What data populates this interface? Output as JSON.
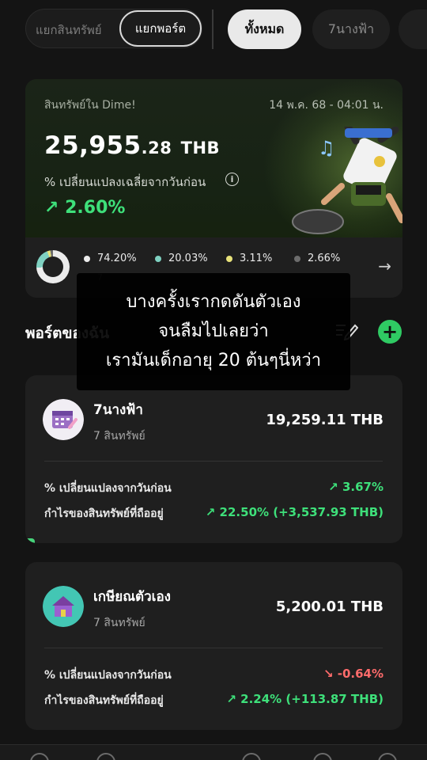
{
  "topbar": {
    "segment_left": "แยกสินทรัพย์",
    "segment_right": "แยกพอร์ต",
    "filter_all": "ทั้งหมด",
    "filter_7": "7นางฟ้า"
  },
  "asset_card": {
    "label": "สินทรัพย์ใน Dime!",
    "date": "14 พ.ค. 68 - 04:01 น.",
    "amount_main": "25,955",
    "amount_decimal": ".28",
    "currency": "THB",
    "change_label": "% เปลี่ยนแปลงเฉลี่ยจากวันก่อน",
    "change_pct": "2.60%",
    "allocation": [
      {
        "pct": "74.20%",
        "color": "#ececec",
        "sub": "7"
      },
      {
        "pct": "20.03%",
        "color": "#7fd1c1",
        "sub": ""
      },
      {
        "pct": "3.11%",
        "color": "#e8e27a",
        "sub": ""
      },
      {
        "pct": "2.66%",
        "color": "#6c6c6c",
        "sub": ""
      }
    ]
  },
  "portfolio_section": {
    "title": "พอร์ตของฉัน"
  },
  "caption": {
    "line1": "บางครั้งเรากดดันตัวเอง",
    "line2": "จนลืมไปเลยว่า",
    "line3": "เรามันเด็กอายุ 20 ต้นๆนี่หว่า"
  },
  "portfolios": [
    {
      "name": "7นางฟ้า",
      "count": "7 สินทรัพย์",
      "value": "19,259.11 THB",
      "change_label": "% เปลี่ยนแปลงจากวันก่อน",
      "change_value": "↗  3.67%",
      "profit_label": "กำไรของสินทรัพย์ที่ถืออยู่",
      "profit_value": "↗ 22.50% (+3,537.93 THB)"
    },
    {
      "name": "เกษียณตัวเอง",
      "count": "7 สินทรัพย์",
      "value": "5,200.01 THB",
      "change_label": "% เปลี่ยนแปลงจากวันก่อน",
      "change_value": "↘  -0.64%",
      "profit_label": "กำไรของสินทรัพย์ที่ถืออยู่",
      "profit_value": "↗ 2.24% (+113.87 THB)"
    }
  ],
  "colors": {
    "accent_green": "#3ee07a",
    "negative_red": "#ff6b6b",
    "add_button": "#2fca63"
  }
}
